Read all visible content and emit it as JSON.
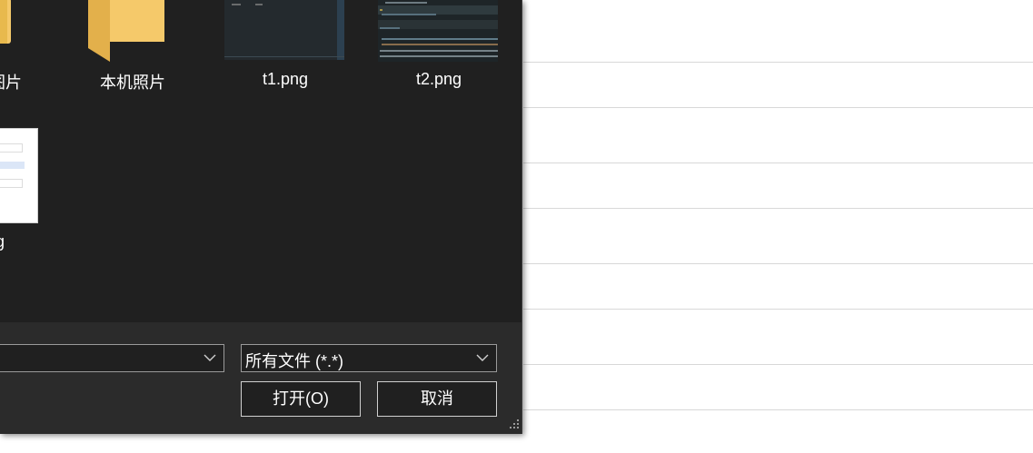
{
  "file_items": [
    {
      "label": "图片"
    },
    {
      "label": "本机照片"
    },
    {
      "label": "t1.png"
    },
    {
      "label": "t2.png"
    },
    {
      "label": "g"
    }
  ],
  "filename_combo": {
    "value": ""
  },
  "filetype_combo": {
    "value": "所有文件 (*.*)"
  },
  "buttons": {
    "open": "打开(O)",
    "cancel": "取消"
  },
  "icons": {
    "folder": "folder-icon",
    "chevron": "chevron-down-icon",
    "grip": "resize-grip-icon"
  },
  "colors": {
    "dialog_bg": "#202020",
    "bottom_bg": "#2b2b2b",
    "folder": "#f5c96a"
  }
}
